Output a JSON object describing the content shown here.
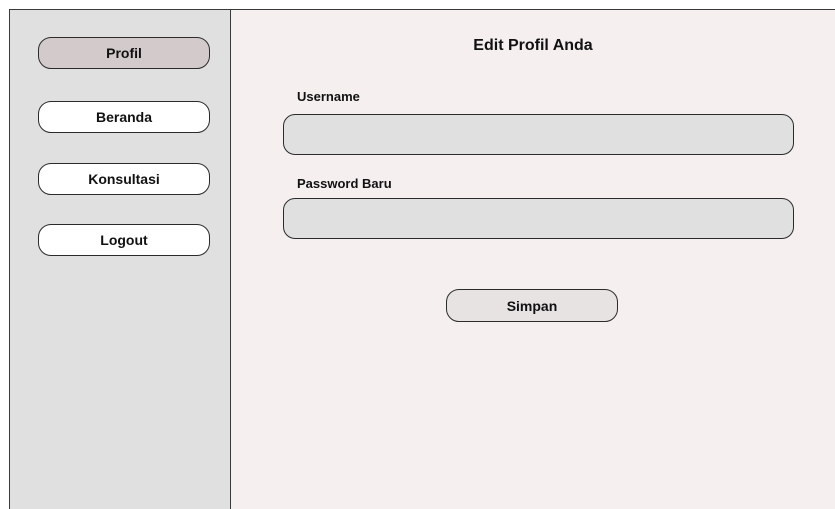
{
  "sidebar": {
    "items": [
      {
        "label": "Profil",
        "active": true
      },
      {
        "label": "Beranda",
        "active": false
      },
      {
        "label": "Konsultasi",
        "active": false
      },
      {
        "label": "Logout",
        "active": false
      }
    ]
  },
  "main": {
    "title": "Edit Profil Anda",
    "fields": [
      {
        "label": "Username",
        "value": ""
      },
      {
        "label": "Password Baru",
        "value": ""
      }
    ],
    "save_label": "Simpan"
  },
  "colors": {
    "sidebar_bg": "#e0e0e0",
    "main_bg": "#f5eff0",
    "active_item_bg": "#d3cbcb",
    "input_bg": "#e0e0e0",
    "border": "#2b2b2b"
  }
}
